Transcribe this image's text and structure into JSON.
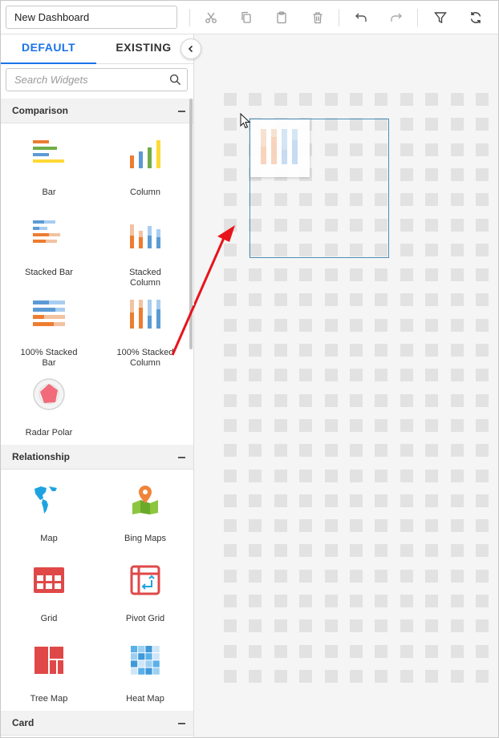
{
  "toolbar": {
    "dashboard_name": "New Dashboard",
    "icons": [
      "cut-icon",
      "copy-icon",
      "paste-icon",
      "delete-icon",
      "undo-icon",
      "redo-icon",
      "filter-icon",
      "refresh-icon"
    ]
  },
  "panel": {
    "tabs": [
      {
        "label": "DEFAULT",
        "active": true
      },
      {
        "label": "EXISTING",
        "active": false
      }
    ],
    "search_placeholder": "Search Widgets",
    "categories": [
      {
        "title": "Comparison",
        "widgets": [
          {
            "label": "Bar",
            "icon": "bar-chart-icon"
          },
          {
            "label": "Column",
            "icon": "column-chart-icon"
          },
          {
            "label": "Stacked Bar",
            "icon": "stacked-bar-chart-icon"
          },
          {
            "label": "Stacked\nColumn",
            "icon": "stacked-column-chart-icon"
          },
          {
            "label": "100% Stacked\nBar",
            "icon": "100-stacked-bar-chart-icon"
          },
          {
            "label": "100% Stacked\nColumn",
            "icon": "100-stacked-column-chart-icon"
          },
          {
            "label": "Radar Polar",
            "icon": "radar-polar-chart-icon"
          }
        ]
      },
      {
        "title": "Relationship",
        "widgets": [
          {
            "label": "Map",
            "icon": "map-icon"
          },
          {
            "label": "Bing Maps",
            "icon": "bing-maps-icon"
          },
          {
            "label": "Grid",
            "icon": "grid-icon"
          },
          {
            "label": "Pivot Grid",
            "icon": "pivot-grid-icon"
          },
          {
            "label": "Tree Map",
            "icon": "tree-map-icon"
          },
          {
            "label": "Heat Map",
            "icon": "heat-map-icon"
          }
        ]
      },
      {
        "title": "Card",
        "widgets": []
      }
    ]
  },
  "colors": {
    "accent": "#1a73e8",
    "orange": "#ed7d31",
    "blue": "#5b9bd5",
    "green": "#70ad47",
    "yellow": "#ffd936",
    "red": "#e04848",
    "arrow": "#e8141b"
  }
}
